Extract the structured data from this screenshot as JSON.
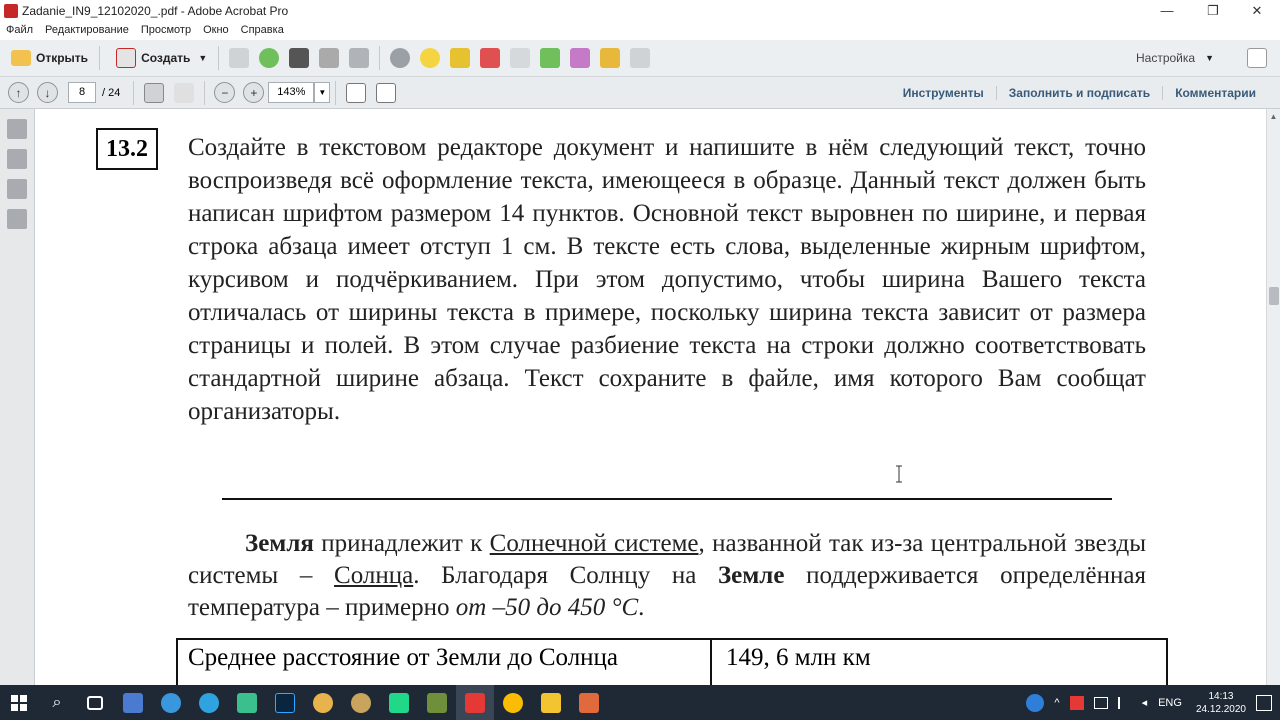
{
  "window": {
    "title": "Zadanie_IN9_12102020_.pdf - Adobe Acrobat Pro",
    "minimize": "—",
    "maximize": "❐",
    "close": "✕"
  },
  "menu": [
    "Файл",
    "Редактирование",
    "Просмотр",
    "Окно",
    "Справка"
  ],
  "toolbar": {
    "open_label": "Открыть",
    "create_label": "Создать",
    "settings_label": "Настройка"
  },
  "nav": {
    "page_current": "8",
    "page_total": "/ 24",
    "zoom": "143%",
    "links": [
      "Инструменты",
      "Заполнить и подписать",
      "Комментарии"
    ]
  },
  "document": {
    "task_number": "13.2",
    "instruction": "Создайте в текстовом редакторе документ и напишите в нём следующий текст, точно воспроизведя всё оформление текста, имеющееся в образце. Данный текст должен быть написан шрифтом размером 14 пунктов. Основной текст выровнен по ширине, и первая строка абзаца имеет отступ 1 см. В тексте есть слова, выделенные жирным шрифтом, курсивом и подчёркиванием. При этом допустимо, чтобы ширина Вашего текста отличалась от ширины текста в примере, поскольку ширина текста зависит от размера страницы и полей. В этом случае разбиение текста на строки должно соответствовать стандартной ширине абзаца.  Текст сохраните в файле, имя которого Вам сообщат организаторы.",
    "sample": {
      "p1_bold": "Земля",
      "p2": " принадлежит к ",
      "p3_underline": "Солнечной системе",
      "p4": ", названной так из-за центральной звезды системы – ",
      "p5_underline": "Солнца",
      "p6": ". Благодаря Солнцу на ",
      "p7_bold": "Земле",
      "p8": " поддерживается определённая температура – примерно ",
      "p9_italic": "от –50 до 450 °С",
      "p10": "."
    },
    "table": {
      "label": "Среднее расстояние от Земли до Солнца",
      "value": "149, 6 млн км"
    }
  },
  "taskbar": {
    "lang": "ENG",
    "time": "14:13",
    "date": "24.12.2020"
  }
}
